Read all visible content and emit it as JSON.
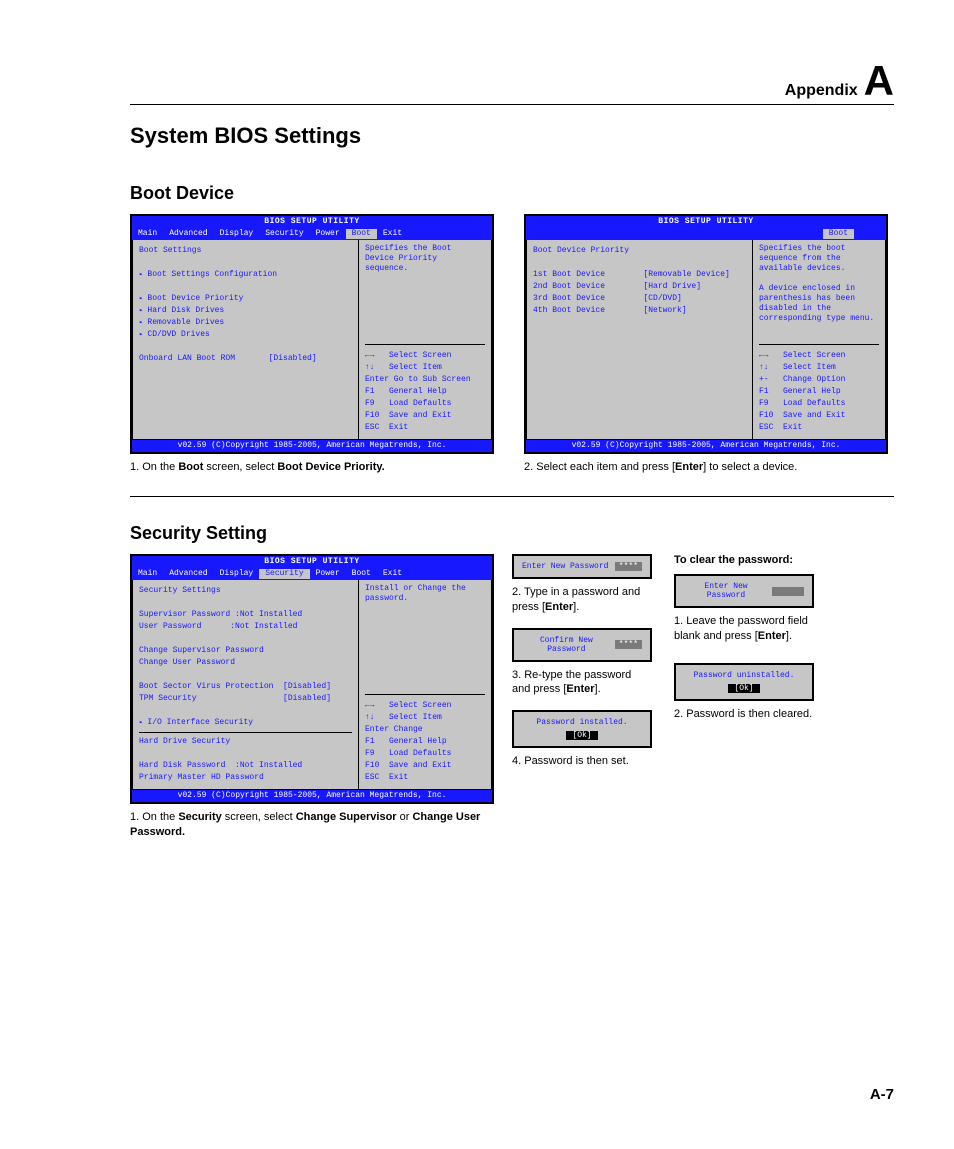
{
  "header": {
    "appendix": "Appendix",
    "letter": "A"
  },
  "h1": "System BIOS Settings",
  "h2a": "Boot Device",
  "h2b": "Security Setting",
  "biosTitle": "BIOS SETUP UTILITY",
  "menu": {
    "main": "Main",
    "adv": "Advanced",
    "disp": "Display",
    "sec": "Security",
    "pow": "Power",
    "boot": "Boot",
    "exit": "Exit"
  },
  "b1": {
    "title": "Boot Settings",
    "items": [
      "Boot Settings Configuration",
      "Boot Device Priority",
      "Hard Disk Drives",
      "Removable Drives",
      "CD/DVD Drives"
    ],
    "lan": "Onboard LAN Boot ROM",
    "lanv": "[Disabled]",
    "desc": "Specifies the Boot Device Priority sequence."
  },
  "b2": {
    "title": "Boot Device Priority",
    "r1a": "1st Boot Device",
    "r1b": "[Removable Device]",
    "r2a": "2nd Boot Device",
    "r2b": "[Hard Drive]",
    "r3a": "3rd Boot Device",
    "r3b": "[CD/DVD]",
    "r4a": "4th Boot Device",
    "r4b": "[Network]",
    "desc": "Specifies the boot sequence from the available devices.",
    "desc2": "A device enclosed in parenthesis has been disabled in the corresponding type menu."
  },
  "help1": {
    "a": "←→   Select Screen",
    "b": "↑↓   Select Item",
    "c": "Enter Go to Sub Screen",
    "d": "F1   General Help",
    "e": "F9   Load Defaults",
    "f": "F10  Save and Exit",
    "g": "ESC  Exit"
  },
  "help2": {
    "a": "←→   Select Screen",
    "b": "↑↓   Select Item",
    "c": "+-   Change Option",
    "d": "F1   General Help",
    "e": "F9   Load Defaults",
    "f": "F10  Save and Exit",
    "g": "ESC  Exit"
  },
  "help3": {
    "a": "←→   Select Screen",
    "b": "↑↓   Select Item",
    "c": "Enter Change",
    "d": "F1   General Help",
    "e": "F9   Load Defaults",
    "f": "F10  Save and Exit",
    "g": "ESC  Exit"
  },
  "footer": "v02.59 (C)Copyright 1985-2005, American Megatrends, Inc.",
  "cap1a": "1. On the ",
  "cap1b": "Boot",
  "cap1c": " screen, select ",
  "cap1d": "Boot Device Priority.",
  "cap2a": "2. Select each item and press [",
  "cap2b": "Enter",
  "cap2c": "] to select a device.",
  "b3": {
    "title": "Security Settings",
    "sp": "Supervisor Password :Not Installed",
    "up": "User Password      :Not Installed",
    "csp": "Change Supervisor Password",
    "cup": "Change User Password",
    "bsv": "Boot Sector Virus Protection  [Disabled]",
    "tpm": "TPM Security                  [Disabled]",
    "iis": "I/O Interface Security",
    "hds": "Hard Drive Security",
    "hdp": "Hard Disk Password  :Not Installed",
    "pmh": "Primary Master HD Password",
    "desc": "Install or Change the password."
  },
  "cap3a": "1. On the ",
  "cap3b": "Security",
  "cap3c": " screen, select ",
  "cap3d": "Change Supervisor",
  "cap3e": " or ",
  "cap3f": "Change User Password.",
  "dlg": {
    "enp": "Enter New Password",
    "stars": "****",
    "cnp": "Confirm New Password",
    "pi": "Password installed.",
    "pu": "Password uninstalled.",
    "ok": "[Ok]"
  },
  "cap4a": "2. Type in a password and press [",
  "cap4b": "Enter",
  "cap4c": "].",
  "cap5a": "3. Re-type the password and press [",
  "cap5b": "Enter",
  "cap5c": "].",
  "cap6": "4. Password is then set.",
  "clearhead": "To clear the password:",
  "cap7a": "1. Leave the password field blank and press [",
  "cap7b": "Enter",
  "cap7c": "].",
  "cap8": "2. Password is then cleared.",
  "pagenum": "A-7"
}
